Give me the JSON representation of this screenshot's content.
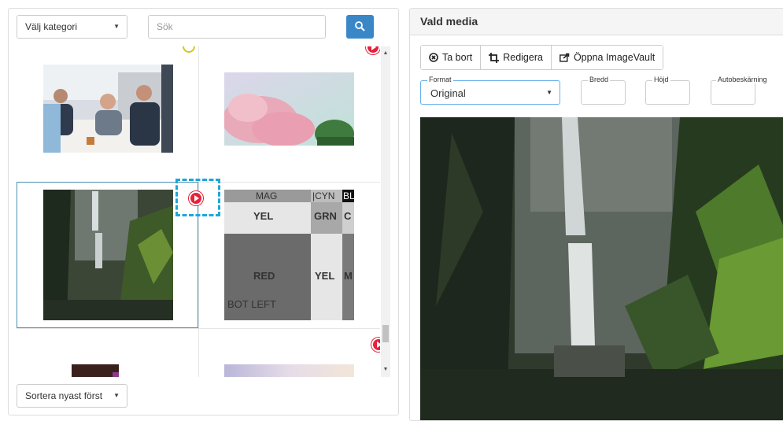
{
  "left_panel": {
    "category_select": "Välj kategori",
    "search_placeholder": "Sök",
    "sort_select": "Sortera nyast först"
  },
  "thumb_labels": {
    "mag": "MAG",
    "cyn": "|CYN",
    "bl": "BL",
    "yel": "YEL",
    "grn": "GRN",
    "c": "C",
    "red": "RED",
    "yel2": "YEL",
    "m": "M",
    "bot_left": "BOT LEFT"
  },
  "right_panel": {
    "title": "Vald media",
    "toolbar": {
      "remove": "Ta bort",
      "edit": "Redigera",
      "open": "Öppna ImageVault"
    },
    "format": {
      "legend": "Format",
      "value": "Original"
    },
    "width_legend": "Bredd",
    "height_legend": "Höjd",
    "autocrop_legend": "Autobeskärning"
  },
  "colors": {
    "accent": "#3a87c8",
    "play": "#e8203a",
    "selection": "#4a8fb0",
    "dash": "#1fa6d8"
  }
}
